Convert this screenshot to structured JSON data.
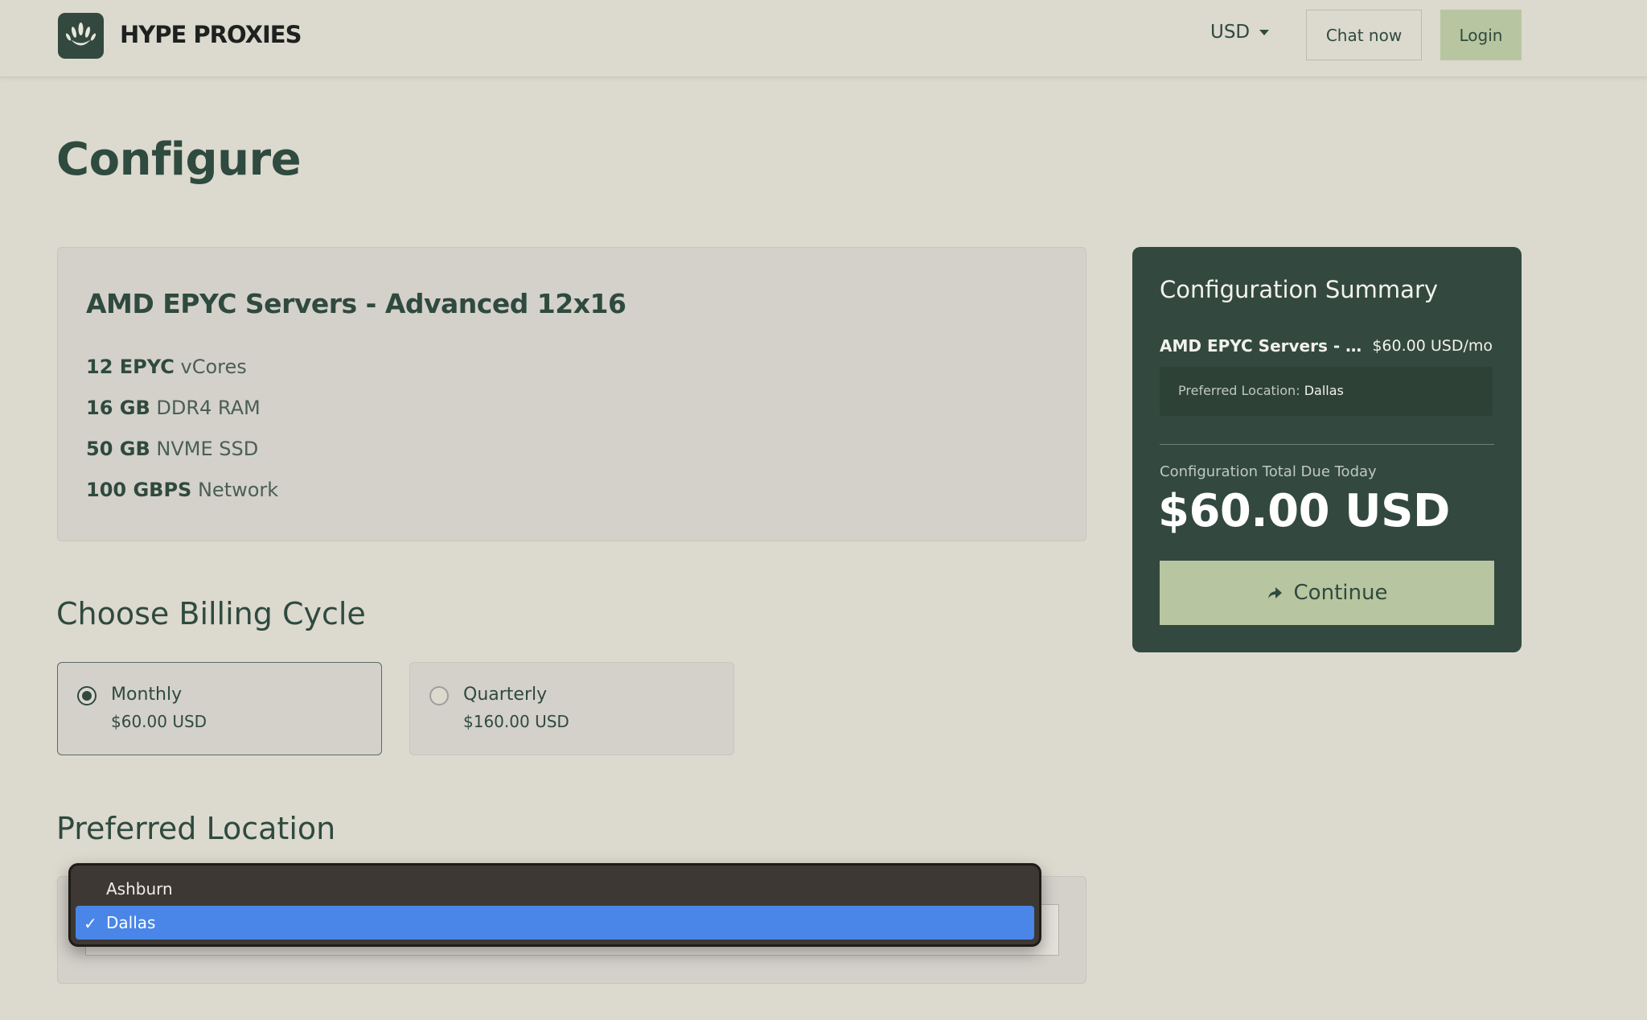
{
  "header": {
    "brand": "HYPE PROXIES",
    "currency": "USD",
    "chat_label": "Chat now",
    "login_label": "Login"
  },
  "page": {
    "title": "Configure"
  },
  "product": {
    "name": "AMD EPYC Servers - Advanced 12x16",
    "specs": [
      {
        "value": "12 EPYC",
        "label": "vCores"
      },
      {
        "value": "16 GB",
        "label": "DDR4 RAM"
      },
      {
        "value": "50 GB",
        "label": "NVME SSD"
      },
      {
        "value": "100 GBPS",
        "label": "Network"
      }
    ]
  },
  "billing": {
    "title": "Choose Billing Cycle",
    "options": [
      {
        "name": "Monthly",
        "price": "$60.00 USD",
        "selected": true
      },
      {
        "name": "Quarterly",
        "price": "$160.00 USD",
        "selected": false
      }
    ]
  },
  "location": {
    "title": "Preferred Location",
    "options": [
      "Ashburn",
      "Dallas"
    ],
    "selected": "Dallas",
    "check": "✓"
  },
  "summary": {
    "title": "Configuration Summary",
    "product_name": "AMD EPYC Servers - Adv...",
    "price": "$60.00 USD/mo",
    "location_label": "Preferred Location:",
    "location_value": "Dallas",
    "total_label": "Configuration Total Due Today",
    "total": "$60.00 USD",
    "continue_label": "Continue"
  },
  "colors": {
    "background": "#dcd9cf",
    "brand_dark": "#33493f",
    "accent_green": "#b7c6a0",
    "dropdown_highlight": "#4a86e8"
  }
}
